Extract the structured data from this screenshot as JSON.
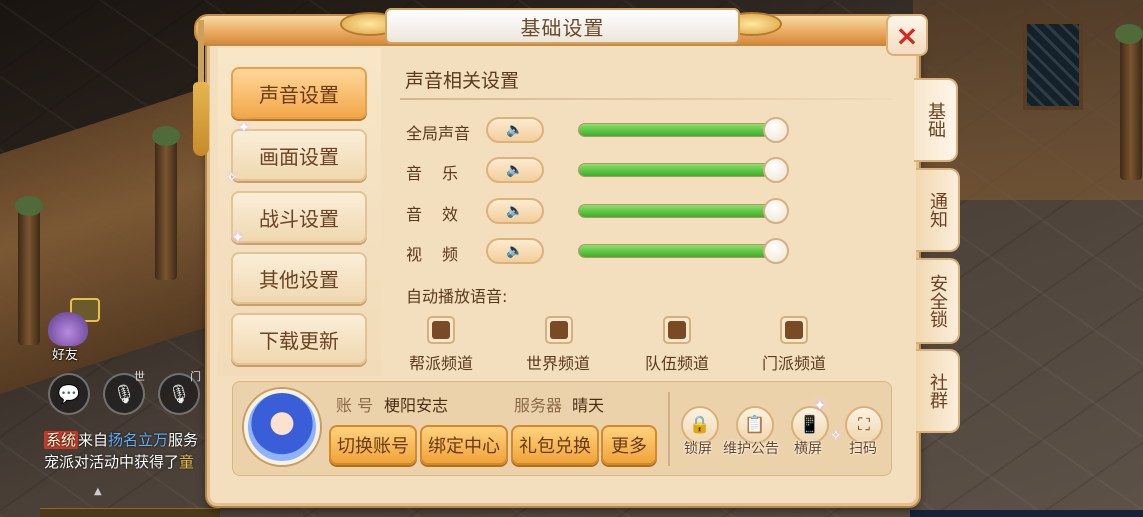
{
  "dialog": {
    "title": "基础设置",
    "close_icon": "×"
  },
  "nav": {
    "items": [
      {
        "label": "声音设置",
        "active": true
      },
      {
        "label": "画面设置",
        "active": false
      },
      {
        "label": "战斗设置",
        "active": false
      },
      {
        "label": "其他设置",
        "active": false
      },
      {
        "label": "下载更新",
        "active": false
      }
    ]
  },
  "side_tabs": [
    {
      "label": "基础",
      "active": true
    },
    {
      "label": "通知",
      "active": false
    },
    {
      "label": "安全锁",
      "active": false
    },
    {
      "label": "社群",
      "active": false
    }
  ],
  "sound": {
    "section_title": "声音相关设置",
    "rows": [
      {
        "label": "全局声音",
        "level": 1.0,
        "icon": "speaker-icon"
      },
      {
        "label": "音乐",
        "level": 1.0,
        "icon": "speaker-icon"
      },
      {
        "label": "音效",
        "level": 1.0,
        "icon": "speaker-icon"
      },
      {
        "label": "视频",
        "level": 1.0,
        "icon": "speaker-icon"
      }
    ],
    "speaker_glyph": "🔈",
    "auto_voice_label": "自动播放语音:",
    "channels": [
      {
        "label": "帮派频道",
        "checked": true
      },
      {
        "label": "世界频道",
        "checked": true
      },
      {
        "label": "队伍频道",
        "checked": true
      },
      {
        "label": "门派频道",
        "checked": true
      }
    ]
  },
  "account": {
    "account_key": "账 号",
    "account_value": "梗阳安志",
    "server_key": "服务器",
    "server_value": "晴天",
    "buttons": [
      "切换账号",
      "绑定中心",
      "礼包兑换",
      "更多"
    ],
    "tools": [
      {
        "label": "锁屏",
        "icon": "lock-icon",
        "glyph": "🔒"
      },
      {
        "label": "维护公告",
        "icon": "notice-board-icon",
        "glyph": "📋"
      },
      {
        "label": "横屏",
        "icon": "rotate-screen-icon",
        "glyph": "📱"
      },
      {
        "label": "扫码",
        "icon": "scan-icon",
        "glyph": "⛶"
      }
    ]
  },
  "hud": {
    "friend_label": "好友",
    "chat_icon": "💬",
    "mic_icon": "🎙",
    "world_small": "世",
    "team_small": "门",
    "chat_line_1_tag": "系统",
    "chat_line_1_a": "来自",
    "chat_line_1_name": "扬名立万",
    "chat_line_1_b": "服务",
    "chat_line_2_a": "宠派对活动中获得了",
    "chat_line_2_item": "童"
  },
  "colors": {
    "accent_orange": "#f0a43a",
    "slider_green": "#3cae28",
    "close_red": "#d22a1e"
  }
}
